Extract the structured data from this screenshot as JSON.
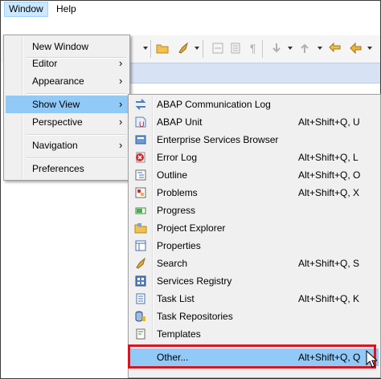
{
  "menubar": {
    "window_label": "Window",
    "help_label": "Help"
  },
  "window_menu": {
    "items": [
      {
        "label": "New Window",
        "submenu": false
      },
      {
        "label": "Editor",
        "submenu": true
      },
      {
        "label": "Appearance",
        "submenu": true
      },
      {
        "label": "Show View",
        "submenu": true,
        "selected": true
      },
      {
        "label": "Perspective",
        "submenu": true
      },
      {
        "label": "Navigation",
        "submenu": true
      },
      {
        "label": "Preferences",
        "submenu": false
      }
    ],
    "submenu_arrow": "›"
  },
  "show_view_menu": {
    "items": [
      {
        "label": "ABAP Communication Log",
        "shortcut": "",
        "icon": "arrows-exchange-icon"
      },
      {
        "label": "ABAP Unit",
        "shortcut": "Alt+Shift+Q, U",
        "icon": "abap-unit-icon"
      },
      {
        "label": "Enterprise Services Browser",
        "shortcut": "",
        "icon": "services-browser-icon"
      },
      {
        "label": "Error Log",
        "shortcut": "Alt+Shift+Q, L",
        "icon": "error-log-icon"
      },
      {
        "label": "Outline",
        "shortcut": "Alt+Shift+Q, O",
        "icon": "outline-icon"
      },
      {
        "label": "Problems",
        "shortcut": "Alt+Shift+Q, X",
        "icon": "problems-icon"
      },
      {
        "label": "Progress",
        "shortcut": "",
        "icon": "progress-icon"
      },
      {
        "label": "Project Explorer",
        "shortcut": "",
        "icon": "project-explorer-icon"
      },
      {
        "label": "Properties",
        "shortcut": "",
        "icon": "properties-icon"
      },
      {
        "label": "Search",
        "shortcut": "Alt+Shift+Q, S",
        "icon": "search-icon"
      },
      {
        "label": "Services Registry",
        "shortcut": "",
        "icon": "services-registry-icon"
      },
      {
        "label": "Task List",
        "shortcut": "Alt+Shift+Q, K",
        "icon": "task-list-icon"
      },
      {
        "label": "Task Repositories",
        "shortcut": "",
        "icon": "task-repositories-icon"
      },
      {
        "label": "Templates",
        "shortcut": "",
        "icon": "templates-icon"
      }
    ],
    "other": {
      "label": "Other...",
      "shortcut": "Alt+Shift+Q, Q"
    }
  },
  "colors": {
    "highlight": "#91c9f7",
    "annotation": "#e3101a",
    "menu_bg": "#f0f0f0"
  }
}
